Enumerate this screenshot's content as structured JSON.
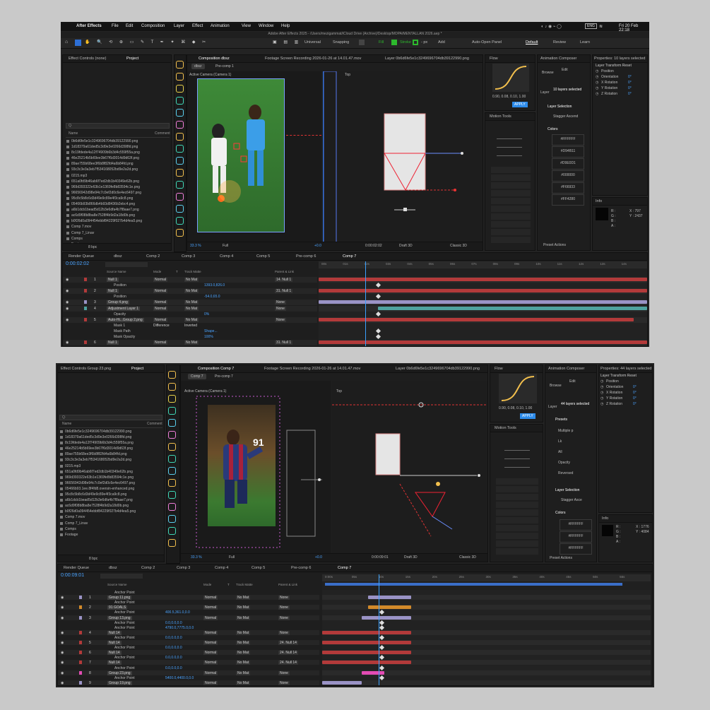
{
  "colors": {
    "accent": "#2d8ceb",
    "layer_red": "#b33a3a",
    "layer_lilac": "#9a93c6",
    "layer_teal": "#4fa3a0",
    "layer_orange": "#d38a2a",
    "layer_pink": "#e24bb3",
    "playhead": "#3aa0ff"
  },
  "w1": {
    "apple_icon": "apple-icon",
    "menu": [
      "After Effects",
      "File",
      "Edit",
      "Composition",
      "Layer",
      "Effect",
      "Animation",
      "View",
      "Window",
      "Help"
    ],
    "status_clock": "Fri 20 Feb 22:18",
    "status_badge": "ENG",
    "title": "Adobe After Effects 2025 - /Users/mezigammat/iCloud Drive (Archive)/Desktop/MOPA/MENTALLAN 2026.aep *",
    "toolbar": {
      "universal": "Universal",
      "snapping": "Snapping",
      "fill": "Fill",
      "stroke": "Stroke",
      "stroke_px": "- px",
      "add": "Add",
      "auto_open": "Auto-Open Panel",
      "workspaces": [
        "Default",
        "Review",
        "Learn"
      ]
    },
    "project_tabs": [
      "Effect Controls (none)",
      "Project"
    ],
    "search_placeholder": "Q∙",
    "columns": [
      "Name",
      "Comment"
    ],
    "files": [
      "0b6d6fe5e1c3249696704db39122990.png",
      "1d18379a61ded5c3d9e3e0266d398fd.png",
      "8c19fdede4a12f74909b6b3d4c559f55a.png",
      "46e25214b5b69ee3b67f6d3014d9d63f.png",
      "89ae755b68ee3f6b8f82fd4a6b84fd.png",
      "93c3c3e3a3eb7f534168052bd9e2a2d.png",
      "0215.mp3",
      "651a0fd9b46ab6f7ed2db1b40349e62b.png",
      "969d393322e63b1e1369fe8b83594c1e.png",
      "96656942d98e94c7c0ef2d0c6e4ec6497.png",
      "95c8c5b8c6d3d49e9c89e4f3ca9c8.png",
      "05466b93b866db4b93d8436b2ebc4.png",
      "a6b1dcb1bead5d12b3e6dfa4b7f8aae7.png",
      "ac6d9f08b8ba8e7528f4b9d2a18d0b.png",
      "b0f26d0a094454ebbf84229f027b4d4ea5.png",
      "Comp 7.mov",
      "Comp 7_Linav",
      "Comps",
      "Footage"
    ],
    "project_footer": "8 bpc",
    "comp_tabs": [
      "Composition dbsz",
      "Footage Screen Recording 2026-01-26 at 14.01.47.mov",
      "Layer 0b6d6fe5e1c3249696704db39122990.png"
    ],
    "viewer_tabs": [
      "dbsz",
      "Pre-comp 1"
    ],
    "camera_label": "Active Camera (Camera 1)",
    "top_label": "Top",
    "viewer_bar": {
      "zoom": "33.3 %",
      "res": "Full",
      "time": "0:00:02:02",
      "renderer": "Draft 3D",
      "view": "Classic 3D",
      "exposure": "+0.0"
    },
    "flow": {
      "title": "Flow",
      "values": "0.90, 0.08, 0.10, 1.00",
      "apply": "APPLY"
    },
    "motion_tools": "Motion Tools",
    "anim_composer": {
      "title": "Animation Composer",
      "browse": "Browse",
      "edit": "Edit",
      "layers_label": "Layer",
      "layers_value": "10 layers selected",
      "layer_selection": "Layer Selection",
      "stagger": "Stagger Ascend",
      "colors_title": "Colors",
      "swatches": [
        "#FFFFFF",
        "#D94B11",
        "#D9E0D1",
        "#000000",
        "#F66933",
        "#FF4280"
      ],
      "preset_actions": "Preset Actions"
    },
    "properties": {
      "title": "Properties: 10 layers selected",
      "section": "Layer Transform Reset",
      "rows": [
        "Position",
        "Orientation",
        "X Rotation",
        "Y Rotation",
        "Z Rotation"
      ],
      "values": [
        "",
        "0°",
        "0°",
        "0°",
        "0°"
      ]
    },
    "info": {
      "title": "Info",
      "x": "X : 797",
      "y": "Y : 2437",
      "r": "R :",
      "g": "G :",
      "b": "B :",
      "a": "A :"
    },
    "timeline_tabs": [
      "Render Queue",
      "dbsz",
      "Comp 2",
      "Comp 3",
      "Comp 4",
      "Comp 5",
      "Pre-comp 6",
      "Comp 7"
    ],
    "timecode": "0:00:02:02",
    "tl_headers": [
      "Source Name",
      "Mode",
      "T",
      "Track Matte",
      "Parent & Link"
    ],
    "ruler": [
      "00s",
      "01s",
      "02s",
      "03s",
      "04s",
      "05s",
      "06s",
      "07s",
      "08s",
      "09s",
      "10s",
      "11s",
      "12s",
      "13s",
      "14s"
    ],
    "layers": [
      {
        "num": "1",
        "name": "Null 1",
        "mode": "Normal",
        "matte": "No Mat",
        "parent": "14. Null 1",
        "bar": "red",
        "start": 0.0,
        "end": 1.0
      },
      {
        "num": "",
        "name": "Position",
        "mode": "",
        "matte": "",
        "parent": "",
        "value": "1393.0,826.0",
        "bar": "lane",
        "start": 0.0,
        "end": 1.0
      },
      {
        "num": "2",
        "name": "Null 1",
        "mode": "Normal",
        "matte": "No Mat",
        "parent": "31. Null 1",
        "bar": "red",
        "start": 0.0,
        "end": 1.0
      },
      {
        "num": "",
        "name": "Position",
        "mode": "",
        "matte": "",
        "parent": "",
        "value": "-54.0,65.0",
        "bar": "lane",
        "start": 0.0,
        "end": 1.0
      },
      {
        "num": "3",
        "name": "Group 4.png",
        "mode": "Normal",
        "matte": "No Mat",
        "parent": "None",
        "bar": "lilac",
        "start": 0.0,
        "end": 1.0
      },
      {
        "num": "4",
        "name": "Adjustment Layer 1",
        "mode": "Normal",
        "matte": "No Mat",
        "parent": "None",
        "bar": "teal",
        "start": 0.18,
        "end": 1.0
      },
      {
        "num": "",
        "name": "Opacity",
        "mode": "",
        "matte": "",
        "parent": "",
        "value": "0%",
        "bar": "lane",
        "start": 0.0,
        "end": 1.0
      },
      {
        "num": "5",
        "name": "Auto-Hi...Group 2.png",
        "mode": "Normal",
        "matte": "No Mat",
        "parent": "None",
        "bar": "red",
        "start": 0.0,
        "end": 0.96
      },
      {
        "num": "",
        "name": "Mask 1",
        "mode": "Difference",
        "matte": "Inverted",
        "parent": "",
        "bar": "lane",
        "start": 0.0,
        "end": 1.0
      },
      {
        "num": "",
        "name": "Mask Path",
        "mode": "",
        "matte": "",
        "parent": "",
        "value": "Shape...",
        "bar": "lane",
        "start": 0.0,
        "end": 1.0
      },
      {
        "num": "",
        "name": "Mask Opacity",
        "mode": "",
        "matte": "",
        "parent": "",
        "value": "100%",
        "bar": "lane",
        "start": 0.0,
        "end": 1.0
      },
      {
        "num": "6",
        "name": "Null 1",
        "mode": "Normal",
        "matte": "No Mat",
        "parent": "31. Null 1",
        "bar": "red",
        "start": 0.0,
        "end": 1.0
      }
    ]
  },
  "w2": {
    "project_tabs": [
      "Effect Controls Group 23.png",
      "Project"
    ],
    "search_placeholder": "Q∙",
    "columns": [
      "Name",
      "Comment"
    ],
    "files": [
      "0b6d6fe5e1c3249696704db39122990.png",
      "1d18379a61ded5c3d9e3e0266d398fd.png",
      "8c19fdede4a12f74909b6b3d4c559f55a.png",
      "46e25214b5b69ee3b67f6d3014d9d63f.png",
      "89ae755b68ee3f6b8f82fd4a6b84fd.png",
      "93c3c3e3a3eb7f534168052bd9e2a2d.png",
      "0215.mp3",
      "651a0fd9b46ab6f7ed2db1b40349e62b.png",
      "969d393322e63b1e1369fe8b83594c1e.png",
      "96656942d98e94c7c0ef2d0c6e4ec6497.png",
      "05466b93.1ee.8f4fd8.oversin-enhanced.png",
      "95c8c5b8c6d3d49e9c89e4f3ca9c8.png",
      "a6b1dcb1bead5d12b3e6dfa4b7f8aae7.png",
      "ac6d9f08b8ba8e7528f4b9d2a18d0b.png",
      "b0f26d0a094454ebbf84229f027b4d4ea5.png",
      "Comp 7.mov",
      "Comp 7_Linav",
      "Comps",
      "Footage"
    ],
    "project_footer": "8 bpc",
    "comp_tabs": [
      "Composition Comp 7",
      "Footage Screen Recording 2026-01-26 at 14.01.47.mov",
      "Layer 0b6d6fe5e1c3249696704db39122990.png"
    ],
    "viewer_tabs": [
      "Comp 7",
      "Pre-comp 7"
    ],
    "camera_label": "Active Camera (Camera 1)",
    "top_label": "Top",
    "badge_number": "91",
    "viewer_bar": {
      "zoom": "33.3 %",
      "res": "Full",
      "time": "0:00:09:01",
      "renderer": "Draft 3D",
      "view": "Classic 3D",
      "exposure": "+0.0"
    },
    "flow": {
      "title": "Flow",
      "values": "0.90, 0.08, 0.10, 1.00",
      "apply": "APPLY"
    },
    "motion_tools": "Motion Tools",
    "anim_composer": {
      "title": "Animation Composer",
      "browse": "Browse",
      "edit": "Edit",
      "layers_label": "Layer",
      "layers_value": "44 layers selected",
      "presets": "Presets",
      "preset_items": [
        "Multiple p",
        "Lk",
        "All",
        "Opacity",
        "Reversed"
      ],
      "layer_selection": "Layer Selection",
      "stagger": "Stagger Asce",
      "colors_title": "Colors",
      "swatches": [
        "#FFFFFF",
        "#FFFFFF",
        "#FFFFFF"
      ],
      "preset_actions": "Preset Actions"
    },
    "properties": {
      "title": "Properties: 44 layers selected",
      "section": "Layer Transform Reset",
      "rows": [
        "Position",
        "Orientation",
        "X Rotation",
        "Y Rotation",
        "Z Rotation"
      ],
      "values": [
        "",
        "0°",
        "0°",
        "0°",
        "0°"
      ]
    },
    "info": {
      "title": "Info",
      "x": "X : 1776",
      "y": "Y : 4084",
      "r": "R :",
      "g": "G :",
      "b": "B :",
      "a": "A :"
    },
    "timeline_tabs": [
      "Render Queue",
      "dbsz",
      "Comp 2",
      "Comp 3",
      "Comp 4",
      "Comp 5",
      "Pre-comp 6",
      "Comp 7"
    ],
    "timecode": "0:00:09:01",
    "tl_headers": [
      "Source Name",
      "Mode",
      "T",
      "Track Matte",
      "Parent & Link"
    ],
    "ruler": [
      "0:00s",
      "05s",
      "10s",
      "15s",
      "20s",
      "25s",
      "30s",
      "35s",
      "40s",
      "45s",
      "50s",
      "55s"
    ],
    "layers": [
      {
        "num": "",
        "name": "Anchor Point",
        "mode": "",
        "matte": "",
        "parent": "",
        "value": "",
        "bar": "lane",
        "start": 0,
        "end": 1
      },
      {
        "num": "1",
        "name": "Group 11.png",
        "mode": "Normal",
        "matte": "No Mat",
        "parent": "None",
        "bar": "lilac",
        "start": 0.14,
        "end": 0.27
      },
      {
        "num": "",
        "name": "Anchor Point",
        "mode": "",
        "matte": "",
        "parent": "",
        "value": "",
        "bar": "lane",
        "start": 0,
        "end": 1
      },
      {
        "num": "2",
        "name": "91 GOALS",
        "mode": "Normal",
        "matte": "No Mat",
        "parent": "None",
        "bar": "orange",
        "start": 0.14,
        "end": 0.27
      },
      {
        "num": "",
        "name": "Anchor Point",
        "mode": "",
        "matte": "",
        "parent": "",
        "value": "400.5,361.0,0.0",
        "bar": "lane",
        "start": 0,
        "end": 1
      },
      {
        "num": "3",
        "name": "Group 13.png",
        "mode": "Normal",
        "matte": "No Mat",
        "parent": "None",
        "bar": "lilac",
        "start": 0.12,
        "end": 0.27
      },
      {
        "num": "",
        "name": "Anchor Point",
        "mode": "",
        "matte": "",
        "parent": "",
        "value": "0.0,0.0,0.0",
        "bar": "lane",
        "start": 0,
        "end": 1
      },
      {
        "num": "",
        "name": "Anchor Point",
        "mode": "",
        "matte": "",
        "parent": "",
        "value": "4790.0,7775.0,0.0",
        "bar": "lane",
        "start": 0,
        "end": 1
      },
      {
        "num": "4",
        "name": "Null 14",
        "mode": "Normal",
        "matte": "No Mat",
        "parent": "None",
        "bar": "red",
        "start": 0.0,
        "end": 0.27
      },
      {
        "num": "",
        "name": "Anchor Point",
        "mode": "",
        "matte": "",
        "parent": "",
        "value": "0.0,0.0,0.0",
        "bar": "lane",
        "start": 0,
        "end": 1
      },
      {
        "num": "5",
        "name": "Null 14",
        "mode": "Normal",
        "matte": "No Mat",
        "parent": "24. Null 14",
        "bar": "red",
        "start": 0.0,
        "end": 0.27
      },
      {
        "num": "",
        "name": "Anchor Point",
        "mode": "",
        "matte": "",
        "parent": "",
        "value": "0.0,0.0,0.0",
        "bar": "lane",
        "start": 0,
        "end": 1
      },
      {
        "num": "6",
        "name": "Null 14",
        "mode": "Normal",
        "matte": "No Mat",
        "parent": "24. Null 14",
        "bar": "red",
        "start": 0.0,
        "end": 0.27
      },
      {
        "num": "",
        "name": "Anchor Point",
        "mode": "",
        "matte": "",
        "parent": "",
        "value": "0.0,0.0,0.0",
        "bar": "lane",
        "start": 0,
        "end": 1
      },
      {
        "num": "7",
        "name": "Null 14",
        "mode": "Normal",
        "matte": "No Mat",
        "parent": "24. Null 14",
        "bar": "red",
        "start": 0.0,
        "end": 0.27
      },
      {
        "num": "",
        "name": "Anchor Point",
        "mode": "",
        "matte": "",
        "parent": "",
        "value": "0.0,0.0,0.0",
        "bar": "lane",
        "start": 0,
        "end": 1
      },
      {
        "num": "8",
        "name": "Group 23.png",
        "mode": "Normal",
        "matte": "No Mat",
        "parent": "None",
        "bar": "pink",
        "start": 0.12,
        "end": 0.19
      },
      {
        "num": "",
        "name": "Anchor Point",
        "mode": "",
        "matte": "",
        "parent": "",
        "value": "5400.0,4400.0,0.0",
        "bar": "lane",
        "start": 0,
        "end": 1
      },
      {
        "num": "9",
        "name": "Group 19.png",
        "mode": "Normal",
        "matte": "No Mat",
        "parent": "None",
        "bar": "lilac",
        "start": 0.0,
        "end": 0.12
      }
    ]
  }
}
